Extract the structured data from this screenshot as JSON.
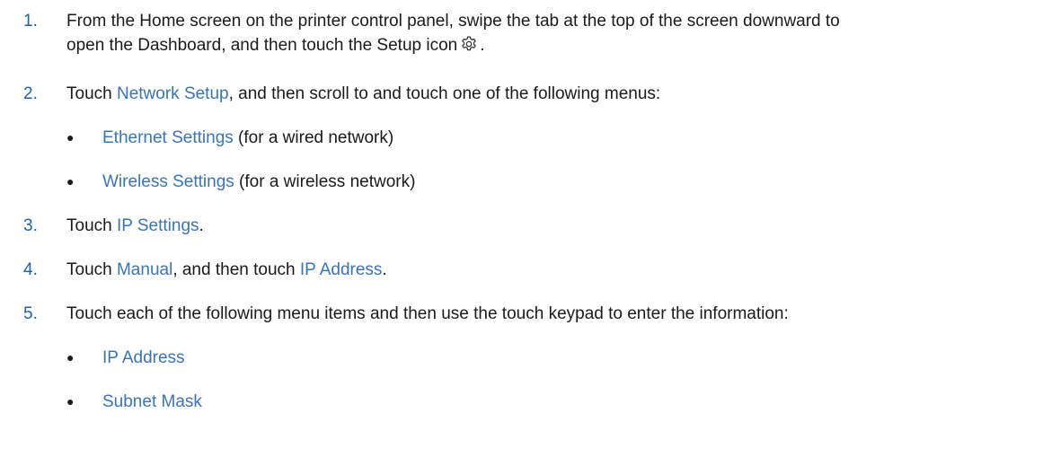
{
  "steps": [
    {
      "number": "1.",
      "text_line1": "From the Home screen on the printer control panel, swipe the tab at the top of the screen downward to",
      "text_line2_prefix": "open the Dashboard, and then touch the Setup icon",
      "text_line2_suffix": "."
    },
    {
      "number": "2.",
      "prefix": "Touch ",
      "ui_label": "Network Setup",
      "suffix": ", and then scroll to and touch one of the following menus:",
      "bullets": [
        {
          "ui_label": "Ethernet Settings",
          "suffix": " (for a wired network)"
        },
        {
          "ui_label": "Wireless Settings",
          "suffix": " (for a wireless network)"
        }
      ]
    },
    {
      "number": "3.",
      "prefix": "Touch ",
      "ui_label": "IP Settings",
      "suffix": "."
    },
    {
      "number": "4.",
      "prefix": "Touch ",
      "ui_label": "Manual",
      "middle": ", and then touch ",
      "ui_label_2": "IP Address",
      "suffix": "."
    },
    {
      "number": "5.",
      "text": "Touch each of the following menu items and then use the touch keypad to enter the information:",
      "bullets": [
        {
          "ui_label": "IP Address"
        },
        {
          "ui_label": "Subnet Mask"
        }
      ]
    }
  ],
  "icons": {
    "setup": "gear-icon"
  },
  "colors": {
    "number": "#1f62a8",
    "ui_label": "#3a74b8",
    "text": "#1a1a1a"
  }
}
